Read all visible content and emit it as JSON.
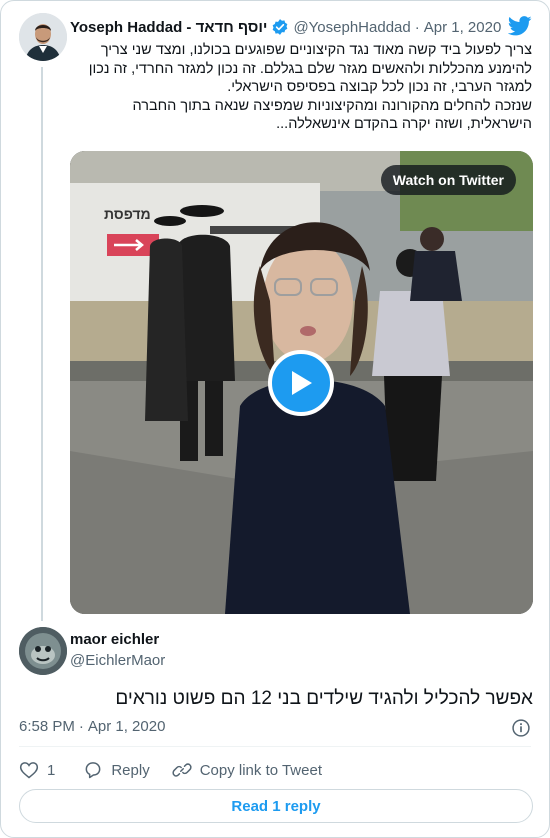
{
  "parent_tweet": {
    "author_name": "Yoseph Haddad - יוסף חדאד",
    "handle": "@YosephHaddad",
    "separator": "·",
    "date": "Apr 1, 2020",
    "text_paragraphs": [
      "צריך לפעול ביד קשה מאוד נגד הקיצוניים שפוגעים בכולנו, ומצד שני צריך להימנע מהכללות ולהאשים מגזר שלם בגללם. זה נכון למגזר החרדי, זה נכון למגזר הערבי, זה נכון לכל קבוצה בפסיפס הישראלי.",
      "שנזכה להחלים מהקורונה ומהקיצוניות שמפיצה שנאה בתוך החברה הישראלית, ושזה יקרה בהקדם אינשאללה..."
    ],
    "video": {
      "watch_label": "Watch on Twitter",
      "sign_text": "מדפסת"
    }
  },
  "reply_tweet": {
    "author_name": "maor eichler",
    "handle": "@EichlerMaor",
    "text": "אפשר להכליל ולהגיד שילדים בני 12 הם פשוט נוראים",
    "time": "6:58 PM",
    "separator": "·",
    "date": "Apr 1, 2020"
  },
  "actions": {
    "like_count": "1",
    "reply_label": "Reply",
    "copy_link_label": "Copy link to Tweet"
  },
  "read_replies_label": "Read 1 reply",
  "colors": {
    "twitter_blue": "#1d9bf0",
    "text_primary": "#0f1419",
    "text_secondary": "#536471",
    "border": "#cfd9de"
  },
  "icons": [
    "twitter-bird-icon",
    "verified-badge-icon",
    "play-icon",
    "info-icon",
    "heart-icon",
    "reply-icon",
    "link-icon"
  ]
}
